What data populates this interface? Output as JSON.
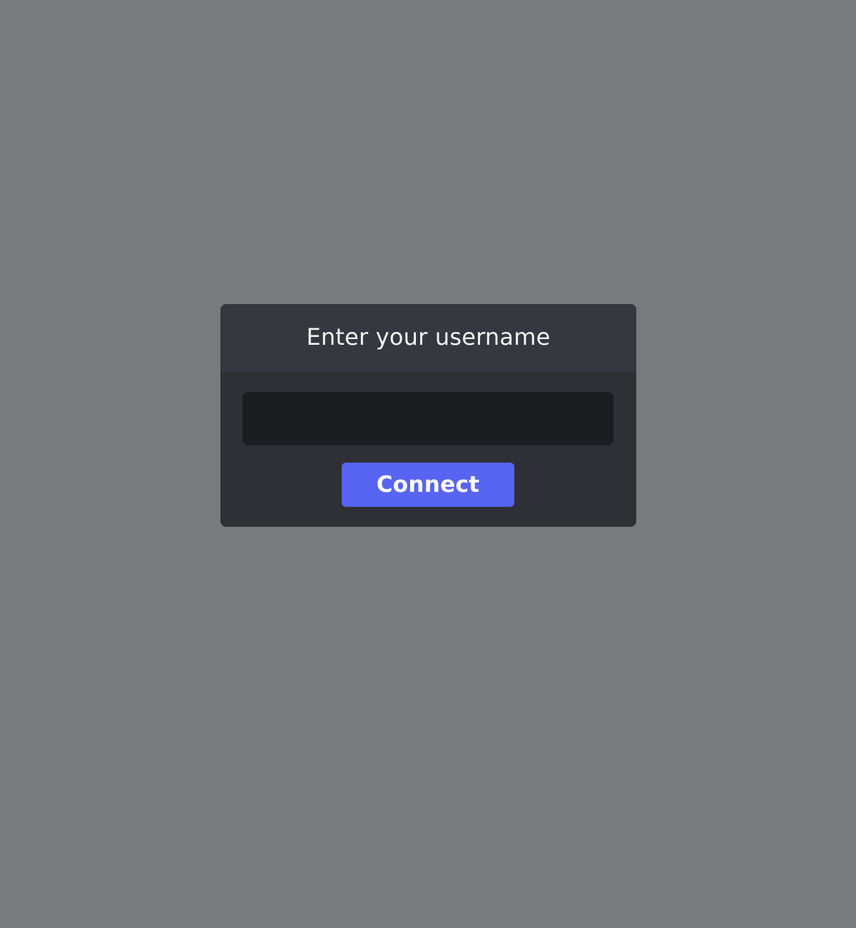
{
  "dialog": {
    "title": "Enter your username",
    "username_input": {
      "value": "",
      "placeholder": ""
    },
    "connect_label": "Connect"
  },
  "colors": {
    "backdrop": "#797a7c",
    "dialog_header": "#36383f",
    "dialog_body": "#2f3035",
    "input_background": "#1c1d21",
    "accent": "#5865f2",
    "text": "#f2f3f5"
  }
}
